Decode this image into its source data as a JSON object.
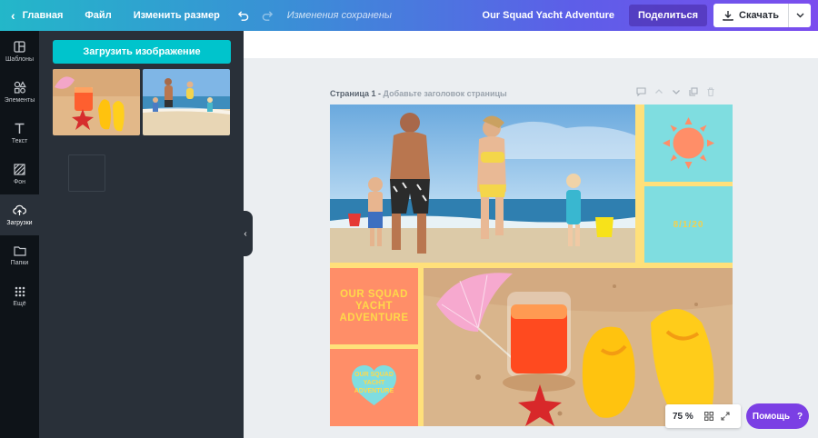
{
  "topbar": {
    "home_label": "Главная",
    "file_label": "Файл",
    "resize_label": "Изменить размер",
    "saved_status": "Изменения сохранены",
    "document_title": "Our Squad Yacht Adventure",
    "share_label": "Поделиться",
    "download_label": "Скачать"
  },
  "rail": {
    "items": [
      {
        "label": "Шаблоны",
        "icon": "templates-icon"
      },
      {
        "label": "Элементы",
        "icon": "elements-icon"
      },
      {
        "label": "Текст",
        "icon": "text-icon"
      },
      {
        "label": "Фон",
        "icon": "background-icon"
      },
      {
        "label": "Загрузки",
        "icon": "upload-cloud-icon"
      },
      {
        "label": "Папки",
        "icon": "folder-icon"
      },
      {
        "label": "Ещё",
        "icon": "more-grid-icon"
      }
    ]
  },
  "panel": {
    "upload_button": "Загрузить изображение"
  },
  "page": {
    "label": "Страница 1 -",
    "placeholder": "Добавьте заголовок страницы"
  },
  "design": {
    "date": "8/1/20",
    "title": "OUR SQUAD YACHT ADVENTURE",
    "heart_text_line1": "OUR SQUAD",
    "heart_text_line2": "YACHT",
    "heart_text_line3": "ADVENTURE"
  },
  "zoom": {
    "level": "75 %"
  },
  "help": {
    "label": "Помощь",
    "glyph": "?"
  },
  "colors": {
    "accent_teal": "#00c4cc",
    "canvas_yellow": "#ffe07a",
    "tile_cyan": "#7fdde0",
    "tile_coral": "#ff8e68",
    "help_purple": "#7b3fe4"
  }
}
